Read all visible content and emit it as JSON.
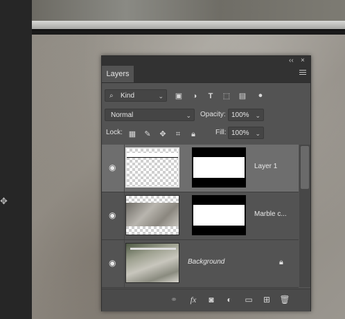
{
  "panel": {
    "title": "Layers",
    "collapse_label": "‹‹",
    "close_label": "×"
  },
  "filter": {
    "kind_label": "Kind",
    "icons": [
      "image-filter-icon",
      "adjustment-filter-icon",
      "type-filter-icon",
      "shape-filter-icon",
      "smart-object-filter-icon",
      "filter-toggle-icon"
    ]
  },
  "blend": {
    "mode": "Normal",
    "opacity_label": "Opacity:",
    "opacity_value": "100%"
  },
  "lock": {
    "label": "Lock:",
    "fill_label": "Fill:",
    "fill_value": "100%"
  },
  "layers": [
    {
      "name": "Layer 1",
      "italic": false,
      "selected": true,
      "locked": false
    },
    {
      "name": "Marble c...",
      "italic": false,
      "selected": false,
      "locked": false
    },
    {
      "name": "Background",
      "italic": true,
      "selected": false,
      "locked": true
    }
  ],
  "footer": {
    "fx_label": "fx",
    "icons": [
      "link-layers-icon",
      "fx-icon",
      "add-mask-icon",
      "new-adjustment-icon",
      "new-group-icon",
      "new-layer-icon",
      "delete-layer-icon"
    ]
  },
  "colors": {
    "panel_bg": "#535353",
    "selected_row": "#6e6e6e"
  }
}
